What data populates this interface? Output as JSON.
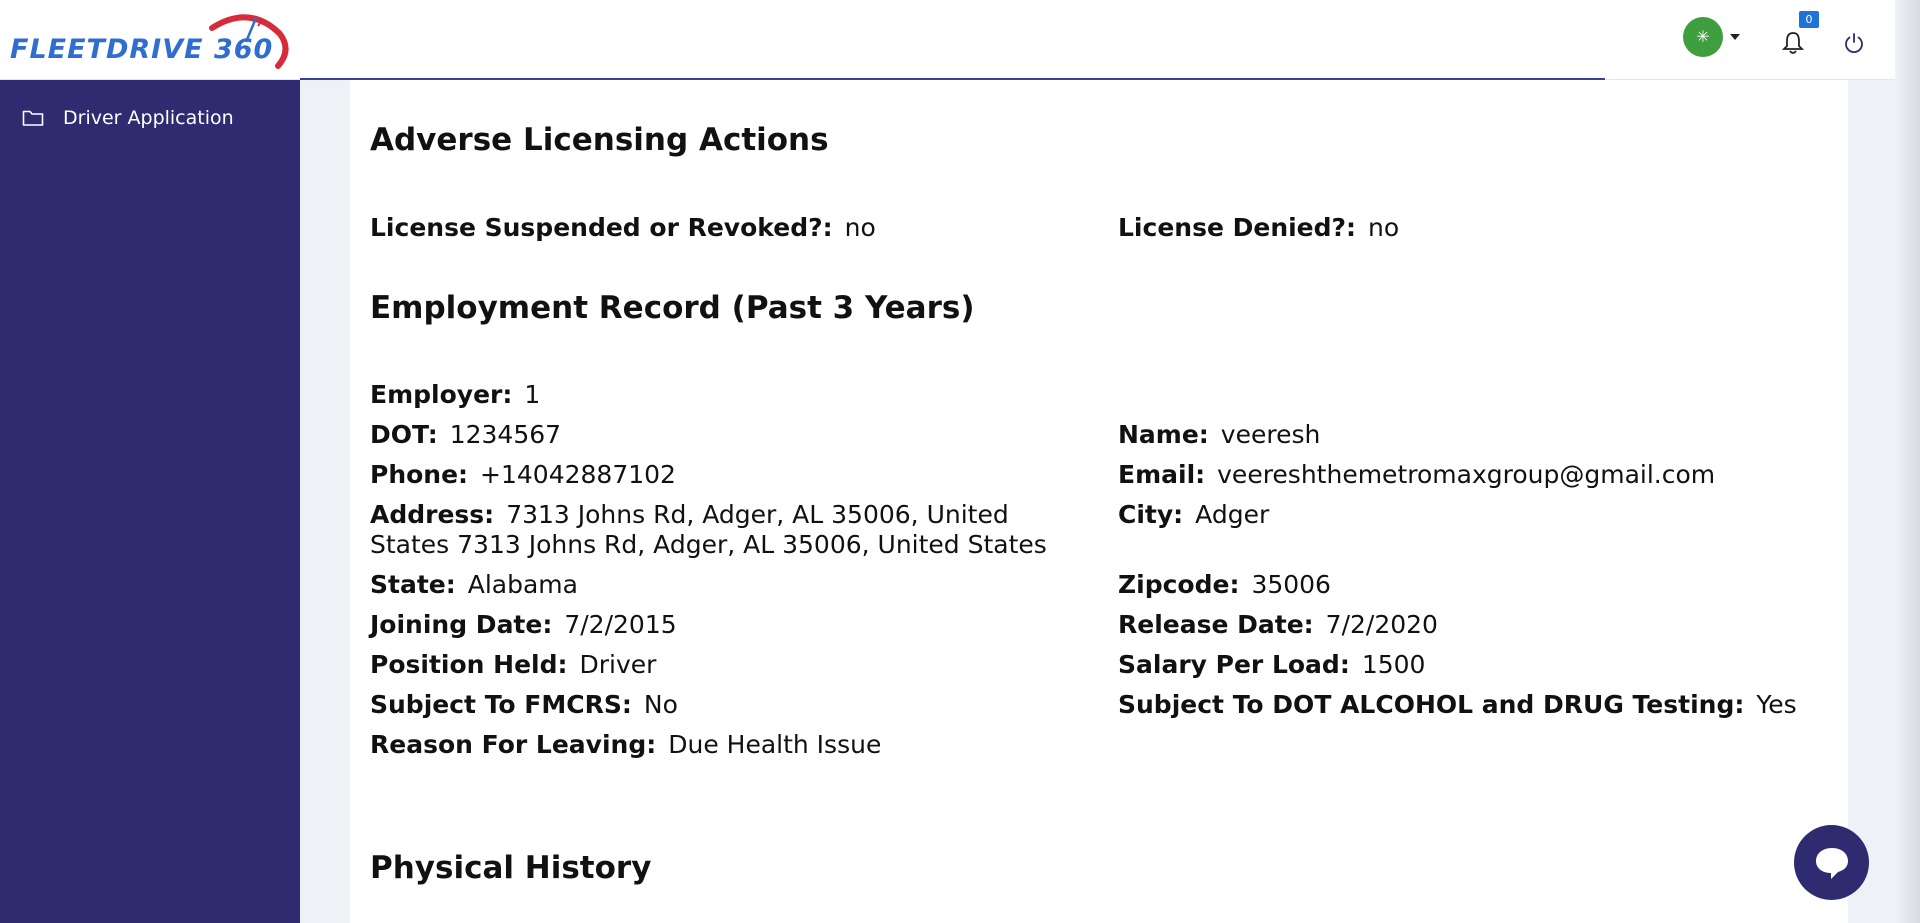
{
  "brand": {
    "logo_text": "FLEETDRIVE 360"
  },
  "header": {
    "avatar_glyph": "✳",
    "notification_count": "0"
  },
  "sidebar": {
    "items": [
      {
        "label": "Driver Application",
        "icon": "folder-icon"
      }
    ]
  },
  "sections": {
    "adverse": {
      "title": "Adverse Licensing Actions",
      "license_suspended": {
        "label": "License Suspended or Revoked?:",
        "value": "no"
      },
      "license_denied": {
        "label": "License Denied?:",
        "value": "no"
      }
    },
    "employment": {
      "title": "Employment Record (Past 3 Years)",
      "employer": {
        "label": "Employer:",
        "value": "1"
      },
      "dot": {
        "label": "DOT:",
        "value": "1234567"
      },
      "name": {
        "label": "Name:",
        "value": "veeresh"
      },
      "phone": {
        "label": "Phone:",
        "value": "+14042887102"
      },
      "email": {
        "label": "Email:",
        "value": "veereshthemetromaxgroup@gmail.com"
      },
      "address": {
        "label": "Address:",
        "value": "7313 Johns Rd, Adger, AL 35006, United States 7313 Johns Rd, Adger, AL 35006, United States"
      },
      "city": {
        "label": "City:",
        "value": "Adger"
      },
      "state": {
        "label": "State:",
        "value": "Alabama"
      },
      "zipcode": {
        "label": "Zipcode:",
        "value": "35006"
      },
      "joining_date": {
        "label": "Joining Date:",
        "value": "7/2/2015"
      },
      "release_date": {
        "label": "Release Date:",
        "value": "7/2/2020"
      },
      "position_held": {
        "label": "Position Held:",
        "value": "Driver"
      },
      "salary_per_load": {
        "label": "Salary Per Load:",
        "value": "1500"
      },
      "subject_fmcrs": {
        "label": "Subject To FMCRS:",
        "value": "No"
      },
      "subject_dot_testing": {
        "label": "Subject To DOT ALCOHOL and DRUG Testing:",
        "value": "Yes"
      },
      "reason_leaving": {
        "label": "Reason For Leaving:",
        "value": "Due Health Issue"
      }
    },
    "physical": {
      "title": "Physical History"
    }
  },
  "colors": {
    "sidebar_bg": "#2e2b70",
    "brand_blue": "#2f6ecf",
    "brand_red": "#d62b3a",
    "avatar_green": "#3f9f3f",
    "badge_blue": "#1e73d8"
  }
}
